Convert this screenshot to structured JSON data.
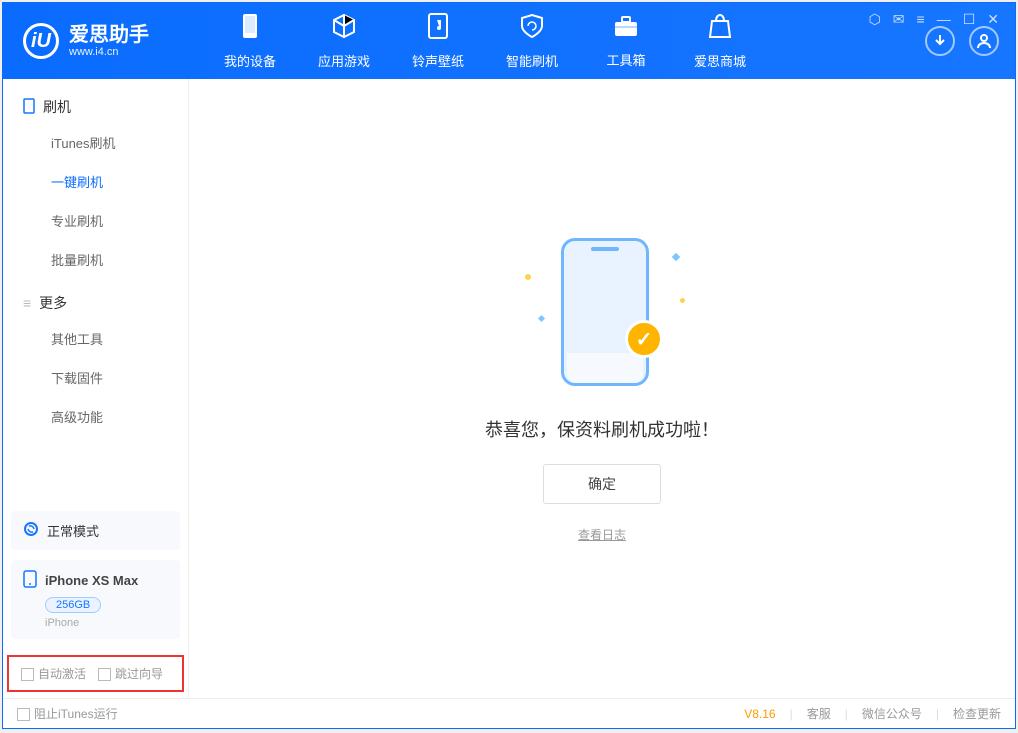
{
  "app": {
    "logo_letter": "iU",
    "title": "爱思助手",
    "subtitle": "www.i4.cn"
  },
  "nav": [
    {
      "label": "我的设备"
    },
    {
      "label": "应用游戏"
    },
    {
      "label": "铃声壁纸"
    },
    {
      "label": "智能刷机"
    },
    {
      "label": "工具箱"
    },
    {
      "label": "爱思商城"
    }
  ],
  "sidebar": {
    "group1": {
      "title": "刷机"
    },
    "items1": [
      {
        "label": "iTunes刷机"
      },
      {
        "label": "一键刷机",
        "active": true
      },
      {
        "label": "专业刷机"
      },
      {
        "label": "批量刷机"
      }
    ],
    "group2": {
      "title": "更多"
    },
    "items2": [
      {
        "label": "其他工具"
      },
      {
        "label": "下载固件"
      },
      {
        "label": "高级功能"
      }
    ],
    "mode_label": "正常模式",
    "device": {
      "name": "iPhone XS Max",
      "capacity": "256GB",
      "type": "iPhone"
    },
    "opt_auto_activate": "自动激活",
    "opt_skip_guide": "跳过向导"
  },
  "result": {
    "message": "恭喜您，保资料刷机成功啦！",
    "ok_btn": "确定",
    "view_log": "查看日志"
  },
  "footer": {
    "stop_itunes": "阻止iTunes运行",
    "version": "V8.16",
    "support": "客服",
    "wechat": "微信公众号",
    "update": "检查更新"
  }
}
